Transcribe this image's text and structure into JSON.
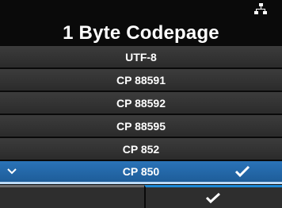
{
  "header": {
    "title": "1 Byte Codepage",
    "icon": "network-icon"
  },
  "list": {
    "items": [
      {
        "label": "UTF-8",
        "selected": false
      },
      {
        "label": "CP 88591",
        "selected": false
      },
      {
        "label": "CP 88592",
        "selected": false
      },
      {
        "label": "CP 88595",
        "selected": false
      },
      {
        "label": "CP 852",
        "selected": false
      },
      {
        "label": "CP 850",
        "selected": true
      }
    ]
  },
  "footer": {
    "left_icon": "",
    "right_icon": "checkmark-icon"
  },
  "colors": {
    "accent": "#1f8ad6",
    "selected_row": "#2a73b8",
    "row": "#353535",
    "background": "#0a0a0a"
  }
}
